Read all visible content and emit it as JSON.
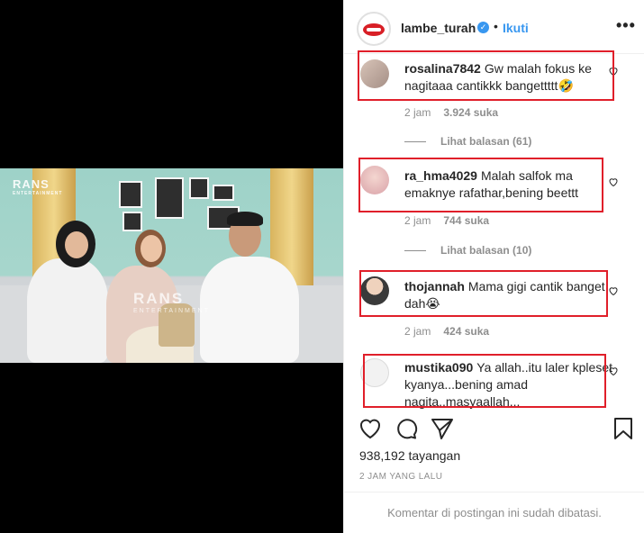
{
  "post": {
    "username": "lambe_turah",
    "follow_label": "Ikuti",
    "separator": "•",
    "more_label": "•••",
    "verified_mark": "✓"
  },
  "video": {
    "logo_text": "RANS",
    "logo_sub": "ENTERTAINMENT",
    "watermark_text": "RANS",
    "watermark_sub": "ENTERTAINMENT"
  },
  "comments": [
    {
      "user": "rosalina7842",
      "text": "Gw malah fokus ke nagitaaa cantikkk bangettttt🤣",
      "time": "2 jam",
      "likes": "3.924 suka",
      "replies": "Lihat balasan (61)"
    },
    {
      "user": "ra_hma4029",
      "text": "Malah salfok ma emaknye rafathar,bening beettt",
      "time": "2 jam",
      "likes": "744 suka",
      "replies": "Lihat balasan (10)"
    },
    {
      "user": "thojannah",
      "text": "Mama gigi cantik banget dah😭",
      "time": "2 jam",
      "likes": "424 suka"
    },
    {
      "user": "mustika090",
      "text": "Ya allah..itu laler kpleset kyanya...bening amad nagita..masyaallah..."
    }
  ],
  "stats": {
    "views": "938,192 tayangan",
    "posted": "2 JAM YANG LALU",
    "comments_limited": "Komentar di postingan ini sudah dibatasi."
  },
  "icons": {
    "heart": "heart-icon",
    "comment": "comment-icon",
    "share": "share-icon",
    "save": "bookmark-icon"
  },
  "colors": {
    "accent_blue": "#3897f0",
    "highlight_red": "#e01f2a",
    "muted_text": "#8e8e8e"
  }
}
